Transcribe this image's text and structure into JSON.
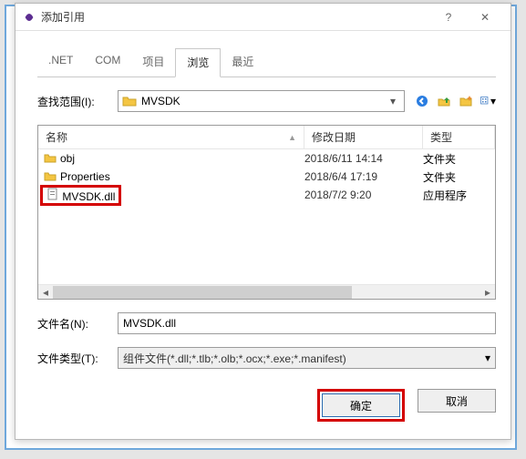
{
  "window": {
    "title": "添加引用",
    "help": "?",
    "close": "✕"
  },
  "tabs": [
    {
      "label": ".NET"
    },
    {
      "label": "COM"
    },
    {
      "label": "项目"
    },
    {
      "label": "浏览",
      "active": true
    },
    {
      "label": "最近"
    }
  ],
  "lookin": {
    "label": "查找范围(I):",
    "value": "MVSDK"
  },
  "columns": {
    "name": "名称",
    "date": "修改日期",
    "type": "类型"
  },
  "rows": [
    {
      "icon": "folder",
      "name": "obj",
      "date": "2018/6/11 14:14",
      "type": "文件夹"
    },
    {
      "icon": "folder",
      "name": "Properties",
      "date": "2018/6/4 17:19",
      "type": "文件夹"
    },
    {
      "icon": "file",
      "name": "MVSDK.dll",
      "date": "2018/7/2 9:20",
      "type": "应用程序",
      "highlight": true
    }
  ],
  "filename": {
    "label": "文件名(N):",
    "value": "MVSDK.dll"
  },
  "filetype": {
    "label": "文件类型(T):",
    "value": "组件文件(*.dll;*.tlb;*.olb;*.ocx;*.exe;*.manifest)"
  },
  "buttons": {
    "ok": "确定",
    "cancel": "取消"
  }
}
